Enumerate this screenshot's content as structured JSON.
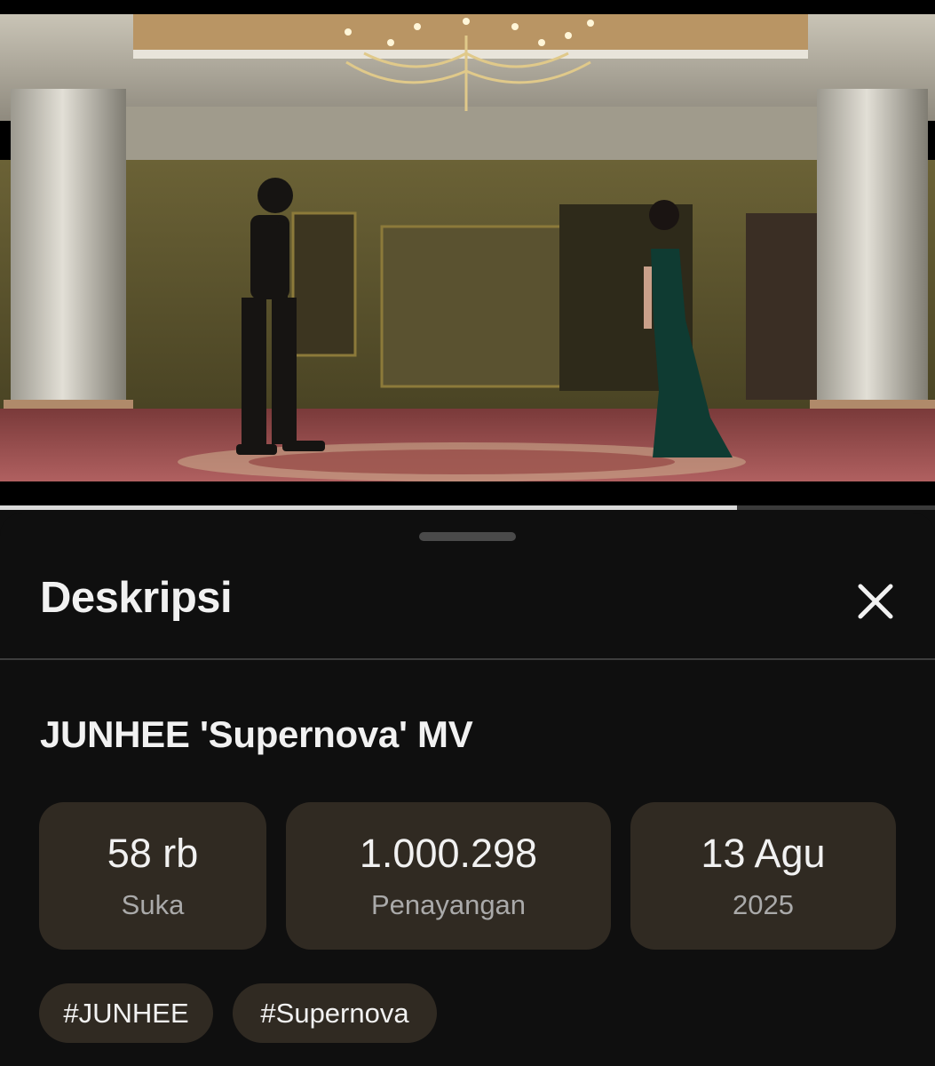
{
  "video": {
    "progress_fraction": 0.788
  },
  "sheet": {
    "title": "Deskripsi",
    "close_icon": "close-icon"
  },
  "description": {
    "video_title": "JUNHEE 'Supernova' MV",
    "stats": [
      {
        "value": "58 rb",
        "label": "Suka"
      },
      {
        "value": "1.000.298",
        "label": "Penayangan"
      },
      {
        "value": "13 Agu",
        "label": "2025"
      }
    ],
    "hashtags": [
      "#JUNHEE",
      "#Supernova"
    ]
  },
  "colors": {
    "background": "#0f0f0f",
    "card": "#302a22",
    "secondary_text": "#aaaaaa",
    "progress": "#d9d9d9"
  }
}
